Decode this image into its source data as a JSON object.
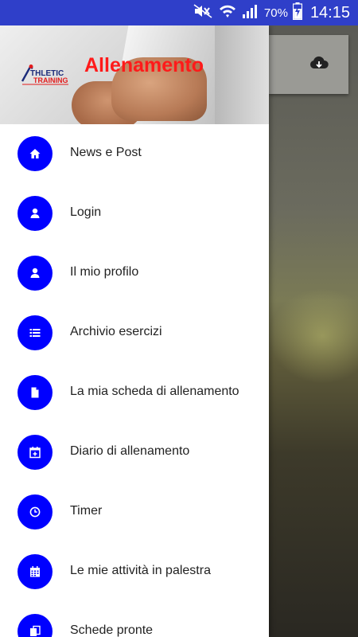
{
  "status_bar": {
    "battery_percent": "70%",
    "time": "14:15",
    "icons": [
      "mute-icon",
      "wifi-icon",
      "signal-icon",
      "battery-charging-icon"
    ]
  },
  "drawer": {
    "header": {
      "title": "Allenamento",
      "logo_text": "ATHLETIC TRAINING"
    },
    "items": [
      {
        "label": "News e Post",
        "icon": "home-icon"
      },
      {
        "label": "Login",
        "icon": "user-icon"
      },
      {
        "label": "Il mio profilo",
        "icon": "user-icon"
      },
      {
        "label": "Archivio esercizi",
        "icon": "list-icon"
      },
      {
        "label": "La mia scheda di allenamento",
        "icon": "document-icon"
      },
      {
        "label": "Diario di allenamento",
        "icon": "calendar-plus-icon"
      },
      {
        "label": "Timer",
        "icon": "clock-icon"
      },
      {
        "label": "Le mie attività in palestra",
        "icon": "calendar-grid-icon"
      },
      {
        "label": "Schede pronte",
        "icon": "copy-icon"
      }
    ]
  },
  "background": {
    "action_icon": "cloud-download-icon"
  },
  "colors": {
    "status_bar": "#2f3fc9",
    "icon_circle": "#0000ff",
    "title": "#ff1a1a"
  }
}
